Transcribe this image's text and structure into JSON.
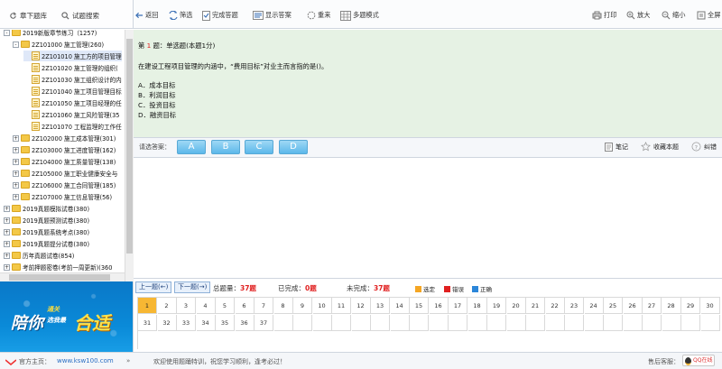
{
  "left_toolbar": {
    "bank_label": "章下题库",
    "search_label": "试题搜索"
  },
  "tree": [
    {
      "label": "2019新版章节练习（1257)",
      "level": 0,
      "kind": "folder",
      "toggle": "-",
      "hl": false
    },
    {
      "label": "2Z101000  施工管理(260)",
      "level": 1,
      "kind": "folder",
      "toggle": "-",
      "hl": false
    },
    {
      "label": "2Z101010  施工方的项目管理",
      "level": 2,
      "kind": "doc",
      "toggle": "",
      "hl": true
    },
    {
      "label": "2Z101020  施工管理的组织(",
      "level": 2,
      "kind": "doc",
      "toggle": "",
      "hl": false
    },
    {
      "label": "2Z101030  施工组织设计的内",
      "level": 2,
      "kind": "doc",
      "toggle": "",
      "hl": false
    },
    {
      "label": "2Z101040  施工项目管理目标",
      "level": 2,
      "kind": "doc",
      "toggle": "",
      "hl": false
    },
    {
      "label": "2Z101050  施工项目经理的任",
      "level": 2,
      "kind": "doc",
      "toggle": "",
      "hl": false
    },
    {
      "label": "2Z101060  施工风险管理(35",
      "level": 2,
      "kind": "doc",
      "toggle": "",
      "hl": false
    },
    {
      "label": "2Z101070  工程监理的工作任",
      "level": 2,
      "kind": "doc",
      "toggle": "",
      "hl": false
    },
    {
      "label": "2Z102000  施工成本管理(301)",
      "level": 1,
      "kind": "folder",
      "toggle": "+",
      "hl": false
    },
    {
      "label": "2Z103000  施工进度管理(162)",
      "level": 1,
      "kind": "folder",
      "toggle": "+",
      "hl": false
    },
    {
      "label": "2Z104000  施工质量管理(138)",
      "level": 1,
      "kind": "folder",
      "toggle": "+",
      "hl": false
    },
    {
      "label": "2Z105000  施工职业健康安全与",
      "level": 1,
      "kind": "folder",
      "toggle": "+",
      "hl": false
    },
    {
      "label": "2Z106000  施工合同管理(185)",
      "level": 1,
      "kind": "folder",
      "toggle": "+",
      "hl": false
    },
    {
      "label": "2Z107000  施工信息管理(56)",
      "level": 1,
      "kind": "folder",
      "toggle": "+",
      "hl": false
    },
    {
      "label": "2019真题模拟试卷(380)",
      "level": 0,
      "kind": "folder",
      "toggle": "+",
      "hl": false
    },
    {
      "label": "2019真题预测试卷(380)",
      "level": 0,
      "kind": "folder",
      "toggle": "+",
      "hl": false
    },
    {
      "label": "2019真题系统考点(380)",
      "level": 0,
      "kind": "folder",
      "toggle": "+",
      "hl": false
    },
    {
      "label": "2019真题提分试卷(380)",
      "level": 0,
      "kind": "folder",
      "toggle": "+",
      "hl": false
    },
    {
      "label": "历年真题试卷(854)",
      "level": 0,
      "kind": "folder",
      "toggle": "+",
      "hl": false
    },
    {
      "label": "考前押题密卷(考前一周更新)(360",
      "level": 0,
      "kind": "folder",
      "toggle": "+",
      "hl": false
    }
  ],
  "banner": {
    "main": "陪你",
    "top": "通关",
    "bottom": "选我最",
    "right": "合适"
  },
  "toolbar": {
    "back": "返回",
    "filter": "筛选",
    "finish": "完成答题",
    "show_answer": "显示答案",
    "redo": "重来",
    "multi_mode": "多题模式",
    "print": "打印",
    "zoom_in": "放大",
    "zoom_out": "缩小",
    "fullscreen": "全屏"
  },
  "question": {
    "header_prefix": "第",
    "number": "1",
    "header_suffix": "题：单选题(本题1分)",
    "stem": "在建设工程项目管理的内涵中，“费用目标”对业主而言指的是()。",
    "options": [
      "A．成本目标",
      "B．利润目标",
      "C．投资目标",
      "D．融资目标"
    ]
  },
  "answer_bar": {
    "prompt": "请选答案：",
    "options": [
      "A",
      "B",
      "C",
      "D"
    ],
    "notes": "笔记",
    "favorite": "收藏本题",
    "report": "纠错"
  },
  "nav": {
    "prev": "上一题(←)",
    "next": "下一题(→)",
    "total_label": "总题量：",
    "total_value": "37题",
    "done_label": "已完成：",
    "done_value": "0题",
    "todo_label": "未完成：",
    "todo_value": "37题",
    "legend": [
      {
        "label": "选定",
        "color": "#f5a623"
      },
      {
        "label": "错误",
        "color": "#e02020"
      },
      {
        "label": "正确",
        "color": "#2b86d9"
      }
    ]
  },
  "question_numbers": [
    "1",
    "2",
    "3",
    "4",
    "5",
    "6",
    "7",
    "8",
    "9",
    "10",
    "11",
    "12",
    "13",
    "14",
    "15",
    "16",
    "17",
    "18",
    "19",
    "20",
    "21",
    "22",
    "23",
    "24",
    "25",
    "26",
    "27",
    "28",
    "29",
    "30",
    "31",
    "32",
    "33",
    "34",
    "35",
    "36",
    "37"
  ],
  "current_question": 1,
  "footer": {
    "site_label": "官方主页：",
    "site_url": "www.ksw100.com",
    "welcome": "欢迎使用题踊特训，祝您学习顺利，逢考必过！",
    "service": "售后客服：",
    "qq": "QQ在线"
  }
}
